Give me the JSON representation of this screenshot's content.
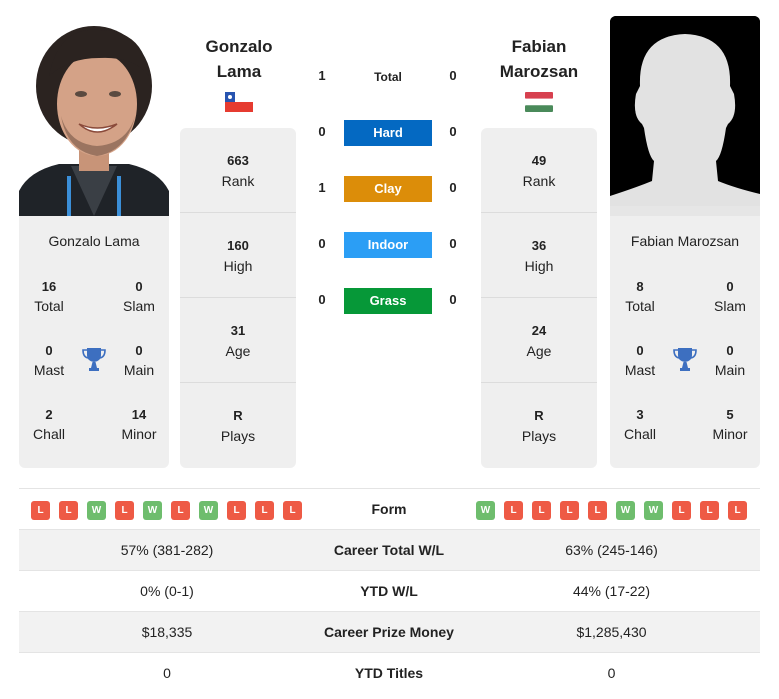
{
  "colors": {
    "hard": "#0469c2",
    "clay": "#dc8d09",
    "indoor": "#2b9ef5",
    "grass": "#069838",
    "win": "#6ebd6d",
    "loss": "#ee5a45",
    "trophy": "#3d6fc0"
  },
  "player1": {
    "first_name": "Gonzalo",
    "last_name": "Lama",
    "full_name": "Gonzalo Lama",
    "country_flag": "chile-flag",
    "rank": {
      "value": "663",
      "label": "Rank"
    },
    "high": {
      "value": "160",
      "label": "High"
    },
    "age": {
      "value": "31",
      "label": "Age"
    },
    "plays": {
      "value": "R",
      "label": "Plays"
    },
    "titles": {
      "total": {
        "value": "16",
        "label": "Total"
      },
      "slam": {
        "value": "0",
        "label": "Slam"
      },
      "mast": {
        "value": "0",
        "label": "Mast"
      },
      "main": {
        "value": "0",
        "label": "Main"
      },
      "chall": {
        "value": "2",
        "label": "Chall"
      },
      "minor": {
        "value": "14",
        "label": "Minor"
      }
    },
    "form": [
      "L",
      "L",
      "W",
      "L",
      "W",
      "L",
      "W",
      "L",
      "L",
      "L"
    ]
  },
  "player2": {
    "first_name": "Fabian",
    "last_name": "Marozsan",
    "full_name": "Fabian Marozsan",
    "country_flag": "hungary-flag",
    "rank": {
      "value": "49",
      "label": "Rank"
    },
    "high": {
      "value": "36",
      "label": "High"
    },
    "age": {
      "value": "24",
      "label": "Age"
    },
    "plays": {
      "value": "R",
      "label": "Plays"
    },
    "titles": {
      "total": {
        "value": "8",
        "label": "Total"
      },
      "slam": {
        "value": "0",
        "label": "Slam"
      },
      "mast": {
        "value": "0",
        "label": "Mast"
      },
      "main": {
        "value": "0",
        "label": "Main"
      },
      "chall": {
        "value": "3",
        "label": "Chall"
      },
      "minor": {
        "value": "5",
        "label": "Minor"
      }
    },
    "form": [
      "W",
      "L",
      "L",
      "L",
      "L",
      "W",
      "W",
      "L",
      "L",
      "L"
    ]
  },
  "h2h": [
    {
      "label": "Total",
      "p1": "1",
      "p2": "0"
    },
    {
      "label": "Hard",
      "p1": "0",
      "p2": "0"
    },
    {
      "label": "Clay",
      "p1": "1",
      "p2": "0"
    },
    {
      "label": "Indoor",
      "p1": "0",
      "p2": "0"
    },
    {
      "label": "Grass",
      "p1": "0",
      "p2": "0"
    }
  ],
  "table": {
    "form_label": "Form",
    "rows": [
      {
        "label": "Career Total W/L",
        "p1": "57% (381-282)",
        "p2": "63% (245-146)"
      },
      {
        "label": "YTD W/L",
        "p1": "0% (0-1)",
        "p2": "44% (17-22)"
      },
      {
        "label": "Career Prize Money",
        "p1": "$18,335",
        "p2": "$1,285,430"
      },
      {
        "label": "YTD Titles",
        "p1": "0",
        "p2": "0"
      }
    ]
  }
}
